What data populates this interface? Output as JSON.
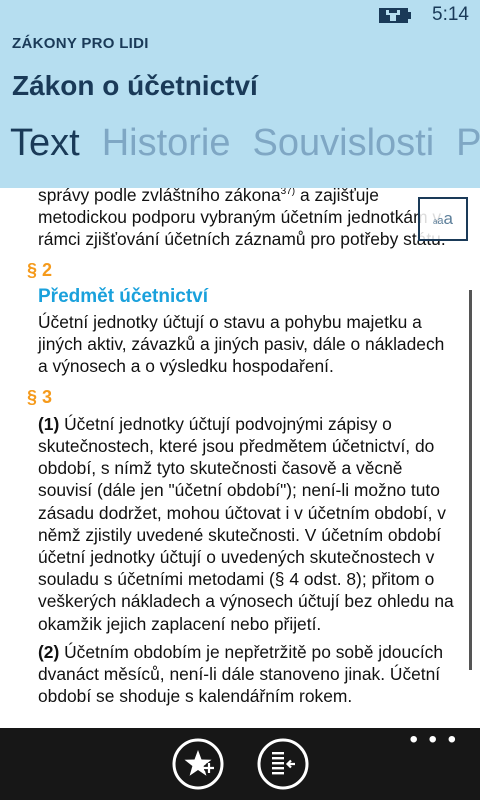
{
  "status_bar": {
    "time": "5:14",
    "battery_icon": "battery-charging-icon"
  },
  "app": {
    "name": "ZÁKONY PRO LIDI"
  },
  "page": {
    "title": "Zákon o účetnictví"
  },
  "pivot": {
    "items": [
      "Text",
      "Historie",
      "Souvislosti",
      "P"
    ],
    "active": "Text"
  },
  "content": {
    "cont_text_before_sup": "správy podle zvláštního zákona",
    "cont_sup": "37)",
    "cont_text_after_sup": " a zajišťuje metodickou podporu vybraným účetním jednotkám v rámci zjišťování účetních záznamů pro potřeby státu.",
    "s2_number": "§ 2",
    "s2_heading": "Předmět účetnictví",
    "s2_text": "Účetní jednotky účtují o stavu a pohybu majetku a jiných aktiv, závazků a jiných pasiv, dále o nákladech a výnosech a o výsledku hospodaření.",
    "s3_number": "§ 3",
    "s3_p1_label": "(1)",
    "s3_p1_text": " Účetní jednotky účtují podvojnými zápisy o skutečnostech, které jsou předmětem účetnictví, do období, s nímž tyto skutečnosti časově a věcně souvisí (dále jen \"účetní období\"); není-li možno tuto zásadu dodržet, mohou účtovat i v účetním období, v němž zjistily uvedené skutečnosti. V účetním období účetní jednotky účtují o uvedených skutečnostech v souladu s účetními metodami (§ 4 odst. 8); přitom o veškerých nákladech a výnosech účtují bez ohledu na okamžik jejich zaplacení nebo přijetí.",
    "s3_p2_label": "(2)",
    "s3_p2_text": " Účetním obdobím je nepřetržitě po sobě jdoucích dvanáct měsíců, není-li dále stanoveno jinak. Účetní období se shoduje s kalendářním rokem."
  },
  "font_size_button": {
    "small": "a",
    "mid": "a",
    "large": "a"
  },
  "app_bar": {
    "more": "• • •",
    "buttons": [
      {
        "icon": "favorite-star-icon"
      },
      {
        "icon": "table-of-contents-icon"
      }
    ]
  },
  "colors": {
    "header_bg": "#b6def0",
    "header_text": "#1a3a58",
    "pivot_inactive": "#7fa7c4",
    "section_number": "#f59a1b",
    "section_heading": "#1aa1dc",
    "app_bar_bg": "#171717"
  }
}
